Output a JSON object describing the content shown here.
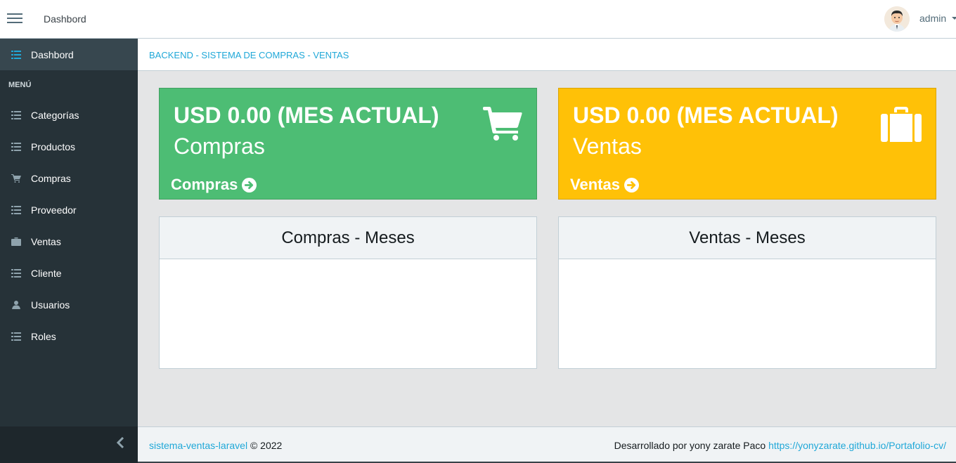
{
  "header": {
    "brand": "Dashbord",
    "user": "admin"
  },
  "sidebar": {
    "section_title": "MENÚ",
    "active_item": {
      "label": "Dashbord",
      "icon": "list-icon"
    },
    "items": [
      {
        "label": "Categorías",
        "icon": "list-icon"
      },
      {
        "label": "Productos",
        "icon": "list-icon"
      },
      {
        "label": "Compras",
        "icon": "cart-icon"
      },
      {
        "label": "Proveedor",
        "icon": "list-icon"
      },
      {
        "label": "Ventas",
        "icon": "briefcase-icon"
      },
      {
        "label": "Cliente",
        "icon": "list-icon"
      },
      {
        "label": "Usuarios",
        "icon": "user-icon"
      },
      {
        "label": "Roles",
        "icon": "list-icon"
      }
    ],
    "collapse_icon": "chevron-left-icon"
  },
  "breadcrumb": "BACKEND - SISTEMA DE COMPRAS - VENTAS",
  "cards": [
    {
      "amount": "USD 0.00 (MES ACTUAL)",
      "subtitle": "Compras",
      "link": "Compras",
      "icon": "cart-icon",
      "color": "#4dbd74"
    },
    {
      "amount": "USD 0.00 (MES ACTUAL)",
      "subtitle": "Ventas",
      "link": "Ventas",
      "icon": "briefcase-icon",
      "color": "#ffc107"
    }
  ],
  "panels": [
    {
      "title": "Compras - Meses"
    },
    {
      "title": "Ventas - Meses"
    }
  ],
  "footer": {
    "project": "sistema-ventas-laravel",
    "copyright": "© 2022",
    "credit": "Desarrollado por yony zarate Paco",
    "url": "https://yonyzarate.github.io/Portafolio-cv/"
  },
  "colors": {
    "sidebar": "#263238",
    "accent": "#20a8d8",
    "success": "#4dbd74",
    "warning": "#ffc107"
  }
}
